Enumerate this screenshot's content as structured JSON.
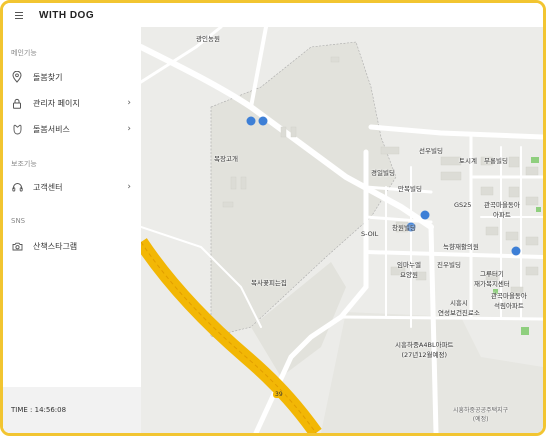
{
  "app": {
    "brand": "WITH DOG"
  },
  "sidebar": {
    "sections": [
      {
        "label": "메인기능"
      },
      {
        "label": "보조기능"
      },
      {
        "label": "SNS"
      }
    ],
    "items": [
      {
        "label": "돌봄찾기",
        "icon": "location-pin-icon"
      },
      {
        "label": "관리자 페이지",
        "icon": "lock-icon"
      },
      {
        "label": "돌봄서비스",
        "icon": "paw-icon"
      },
      {
        "label": "고객센터",
        "icon": "headset-icon"
      },
      {
        "label": "산책스타그램",
        "icon": "camera-icon"
      }
    ],
    "time": "TIME : 14:56:08"
  },
  "map": {
    "labels": {
      "gwangin": "광인농원",
      "mokjang": "목장고개",
      "boksagol": "복사꽃피는집",
      "seonwoo": "선우빌딩",
      "toshigye": "토시계",
      "mooryang": "무룡빌딩",
      "gyeongil": "경일빌딩",
      "manbok": "만복빌딩",
      "gs25": "GS25",
      "gwangokA": "관곡마을동아\n아파트",
      "soil": "S-OIL",
      "changwon": "창원빌딩",
      "nokhyang": "녹향재활의원",
      "imaneul": "임마누엘\n요양원",
      "jinwoo": "진우빌딩",
      "grutaegi": "그루터기\n재가복지센터",
      "gwangokB": "관곡마을동아\n석림아파트",
      "siheung_health": "시흥시\n연성보건진료소",
      "a4bl": "시흥하중A4BL아파트\n(27년12월예정)",
      "district": "시흥하중공공주택지구\n(예정)",
      "route_number": "39"
    },
    "colors": {
      "land": "#ecece9",
      "park": "#e3e3de",
      "road": "#ffffff",
      "highway": "#f2b705",
      "bus": "#3d7fd6"
    }
  }
}
